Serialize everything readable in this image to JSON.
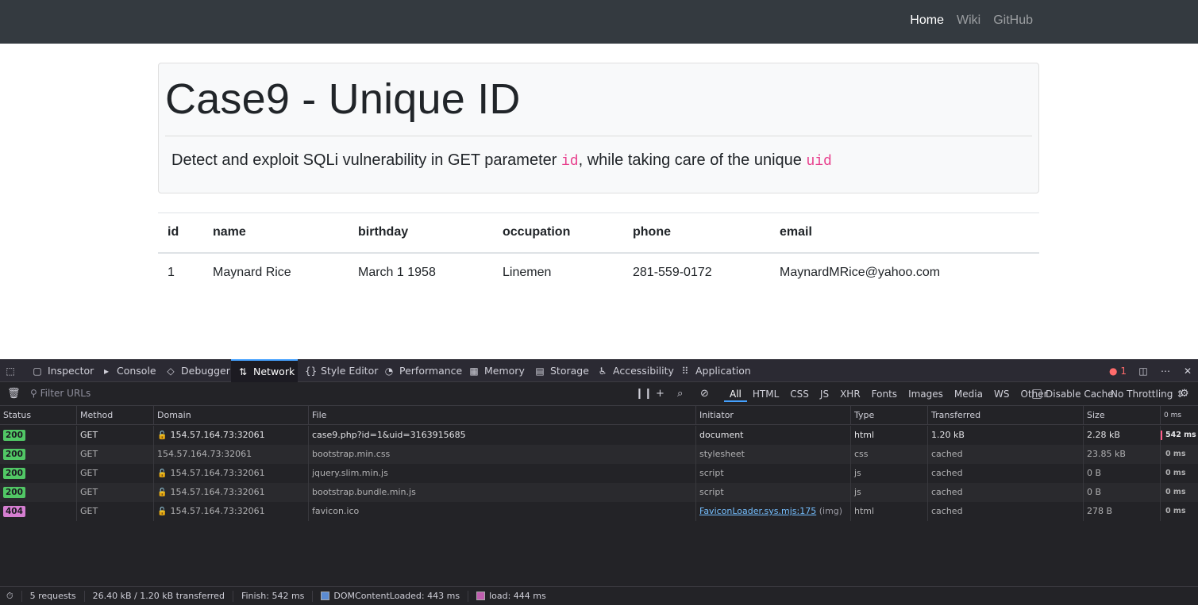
{
  "nav": {
    "links": [
      "Home",
      "Wiki",
      "GitHub"
    ]
  },
  "jumbotron": {
    "title": "Case9 - Unique ID",
    "desc_before": "Detect and exploit SQLi vulnerability in GET parameter ",
    "code1": "id",
    "desc_middle": ", while taking care of the unique ",
    "code2": "uid"
  },
  "table": {
    "headers": [
      "id",
      "name",
      "birthday",
      "occupation",
      "phone",
      "email"
    ],
    "rows": [
      [
        "1",
        "Maynard Rice",
        "March 1 1958",
        "Linemen",
        "281-559-0172",
        "MaynardMRice@yahoo.com"
      ]
    ]
  },
  "devtools": {
    "tabs": [
      "Inspector",
      "Console",
      "Debugger",
      "Network",
      "Style Editor",
      "Performance",
      "Memory",
      "Storage",
      "Accessibility",
      "Application"
    ],
    "error_count": "1",
    "filter_placeholder": "Filter URLs",
    "type_filters": [
      "All",
      "HTML",
      "CSS",
      "JS",
      "XHR",
      "Fonts",
      "Images",
      "Media",
      "WS",
      "Other"
    ],
    "disable_cache": "Disable Cache",
    "throttling": "No Throttling",
    "columns": [
      "Status",
      "Method",
      "Domain",
      "File",
      "Initiator",
      "Type",
      "Transferred",
      "Size",
      "0 ms"
    ],
    "requests": [
      {
        "status": "200",
        "method": "GET",
        "domain": "154.57.164.73:32061",
        "file": "case9.php?id=1&uid=3163915685",
        "initiator": "document",
        "initiator_extra": "",
        "type": "html",
        "transferred": "1.20 kB",
        "size": "2.28 kB",
        "time": "542 ms"
      },
      {
        "status": "200",
        "method": "GET",
        "domain": "154.57.164.73:32061",
        "file": "bootstrap.min.css",
        "initiator": "stylesheet",
        "initiator_extra": "",
        "type": "css",
        "transferred": "cached",
        "size": "23.85 kB",
        "time": "0 ms"
      },
      {
        "status": "200",
        "method": "GET",
        "domain": "154.57.164.73:32061",
        "file": "jquery.slim.min.js",
        "initiator": "script",
        "initiator_extra": "",
        "type": "js",
        "transferred": "cached",
        "size": "0 B",
        "time": "0 ms"
      },
      {
        "status": "200",
        "method": "GET",
        "domain": "154.57.164.73:32061",
        "file": "bootstrap.bundle.min.js",
        "initiator": "script",
        "initiator_extra": "",
        "type": "js",
        "transferred": "cached",
        "size": "0 B",
        "time": "0 ms"
      },
      {
        "status": "404",
        "method": "GET",
        "domain": "154.57.164.73:32061",
        "file": "favicon.ico",
        "initiator": "FaviconLoader.sys.mjs:175",
        "initiator_extra": "(img)",
        "type": "html",
        "transferred": "cached",
        "size": "278 B",
        "time": "0 ms"
      }
    ],
    "summary": {
      "requests": "5 requests",
      "transferred": "26.40 kB / 1.20 kB transferred",
      "finish": "Finish: 542 ms",
      "domcontentloaded": "DOMContentLoaded: 443 ms",
      "load": "load: 444 ms"
    },
    "colors": {
      "accent": "#45a1ff",
      "ok": "#51c765",
      "notfound": "#d57ed1",
      "dcl": "#5b8bd1",
      "load": "#c05fb0"
    }
  }
}
